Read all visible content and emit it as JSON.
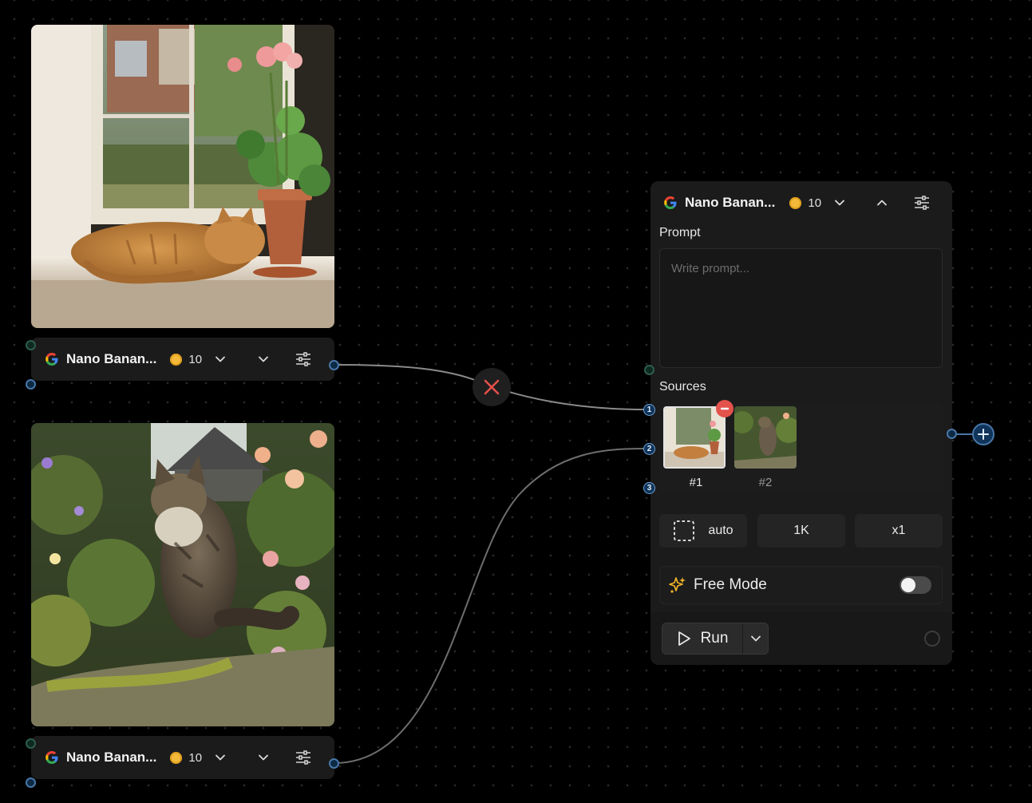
{
  "canvas": {
    "background": "#000000"
  },
  "image_nodes": [
    {
      "image_subject": "orange tabby cat sleeping on a windowsill next to a potted pink geranium",
      "model_name": "Nano Banan...",
      "credits": "10"
    },
    {
      "image_subject": "long-haired tabby cat sitting on a mossy stone wall among garden flowers",
      "model_name": "Nano Banan...",
      "credits": "10"
    }
  ],
  "main_node": {
    "model_name": "Nano Banan...",
    "credits": "10",
    "prompt_label": "Prompt",
    "prompt_placeholder": "Write prompt...",
    "sources_label": "Sources",
    "sources": [
      {
        "label": "#1"
      },
      {
        "label": "#2"
      }
    ],
    "input_ports": [
      "1",
      "2",
      "3"
    ],
    "aspect_label": "auto",
    "resolution_label": "1K",
    "count_label": "x1",
    "free_mode_label": "Free Mode",
    "free_mode_enabled": false,
    "run_label": "Run"
  },
  "colors": {
    "accent_blue": "#4877a8",
    "coin": "#f3b93a",
    "disconnect_red": "#e5504a",
    "free_mode_icon": "#f0b428"
  }
}
